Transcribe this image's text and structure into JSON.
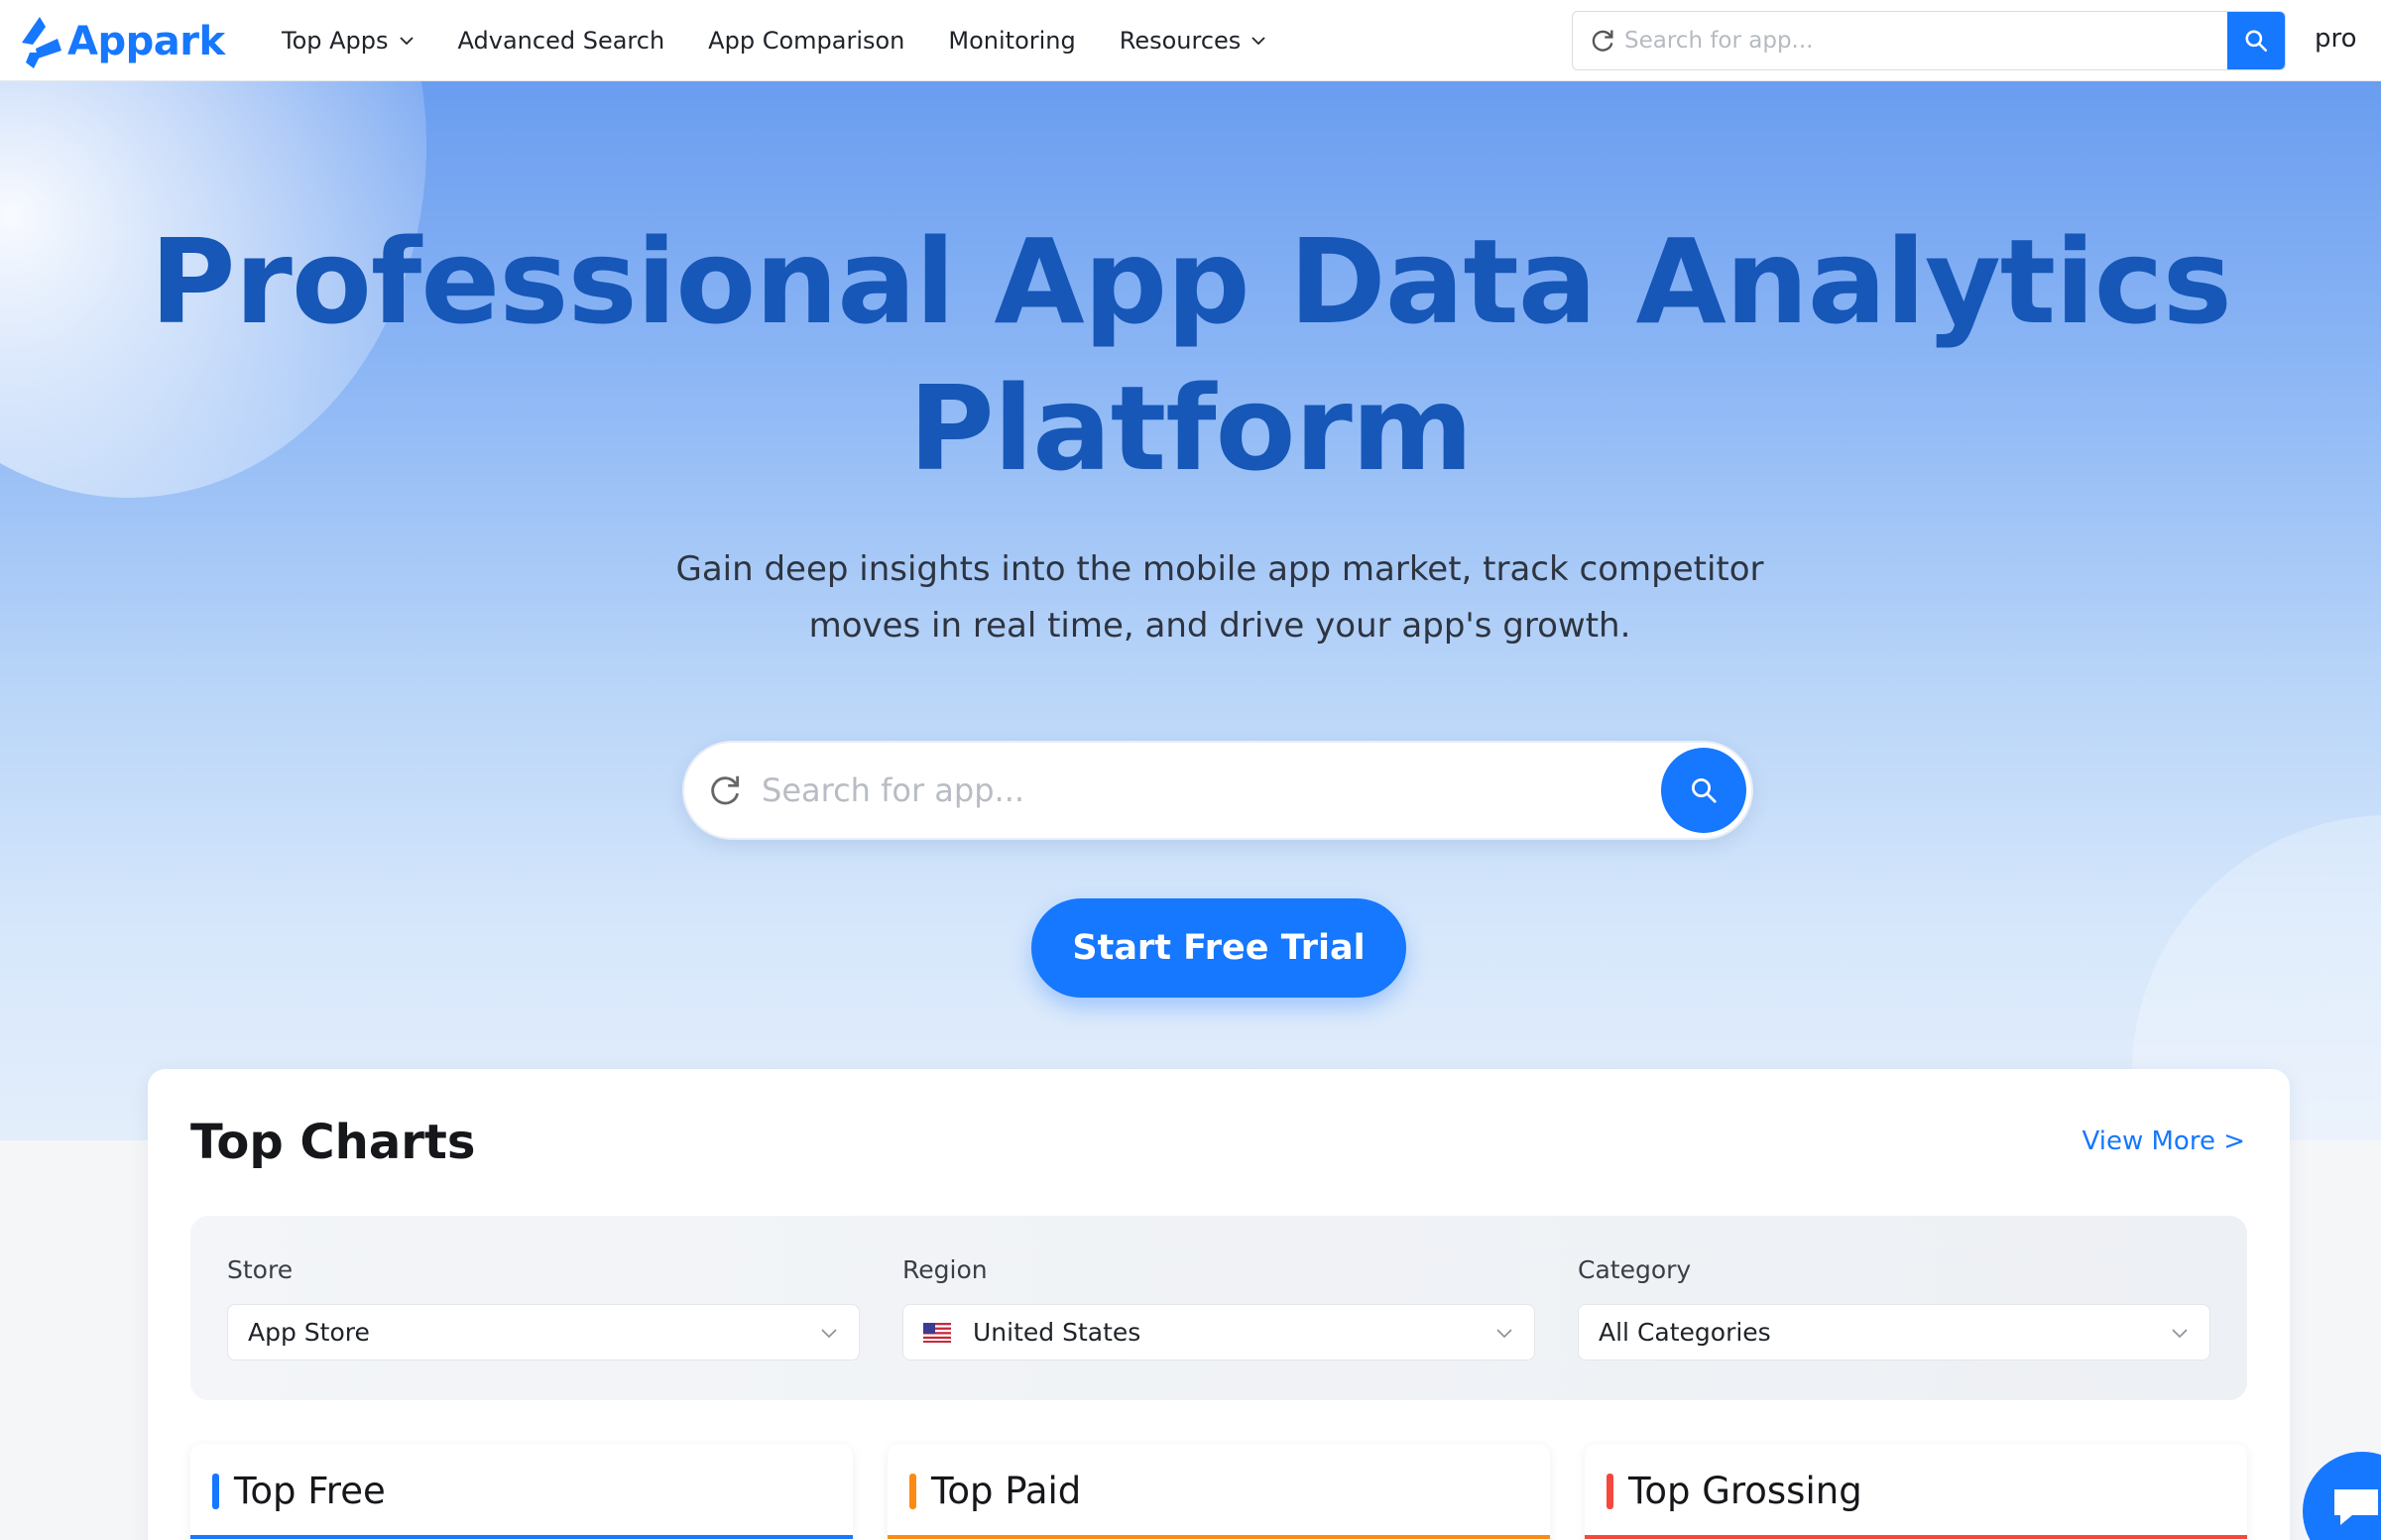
{
  "brand": {
    "name": "Appark",
    "color": "#1677ff"
  },
  "nav": {
    "items": [
      {
        "label": "Top Apps",
        "dropdown": true
      },
      {
        "label": "Advanced Search",
        "dropdown": false
      },
      {
        "label": "App Comparison",
        "dropdown": false
      },
      {
        "label": "Monitoring",
        "dropdown": false
      },
      {
        "label": "Resources",
        "dropdown": true
      }
    ],
    "search_placeholder": "Search for app...",
    "user_label": "pro"
  },
  "hero": {
    "title_line1": "Professional App Data Analytics",
    "title_line2": "Platform",
    "subtitle_line1": "Gain deep insights into the mobile app market, track competitor",
    "subtitle_line2": "moves in real time, and drive your app's growth.",
    "search_placeholder": "Search for app...",
    "cta_label": "Start Free Trial"
  },
  "top_charts": {
    "title": "Top Charts",
    "view_more": "View More >",
    "filters": {
      "store": {
        "label": "Store",
        "value": "App Store"
      },
      "region": {
        "label": "Region",
        "value": "United States",
        "flag": "us-flag-icon"
      },
      "category": {
        "label": "Category",
        "value": "All Categories"
      }
    },
    "lists": [
      {
        "title": "Top Free",
        "color": "#1677ff"
      },
      {
        "title": "Top Paid",
        "color": "#fa8c16"
      },
      {
        "title": "Top Grossing",
        "color": "#f5483b"
      }
    ]
  },
  "colors": {
    "accent": "#1677ff",
    "hero_title": "#1657b8",
    "top_paid": "#fa8c16",
    "top_grossing": "#f5483b"
  }
}
